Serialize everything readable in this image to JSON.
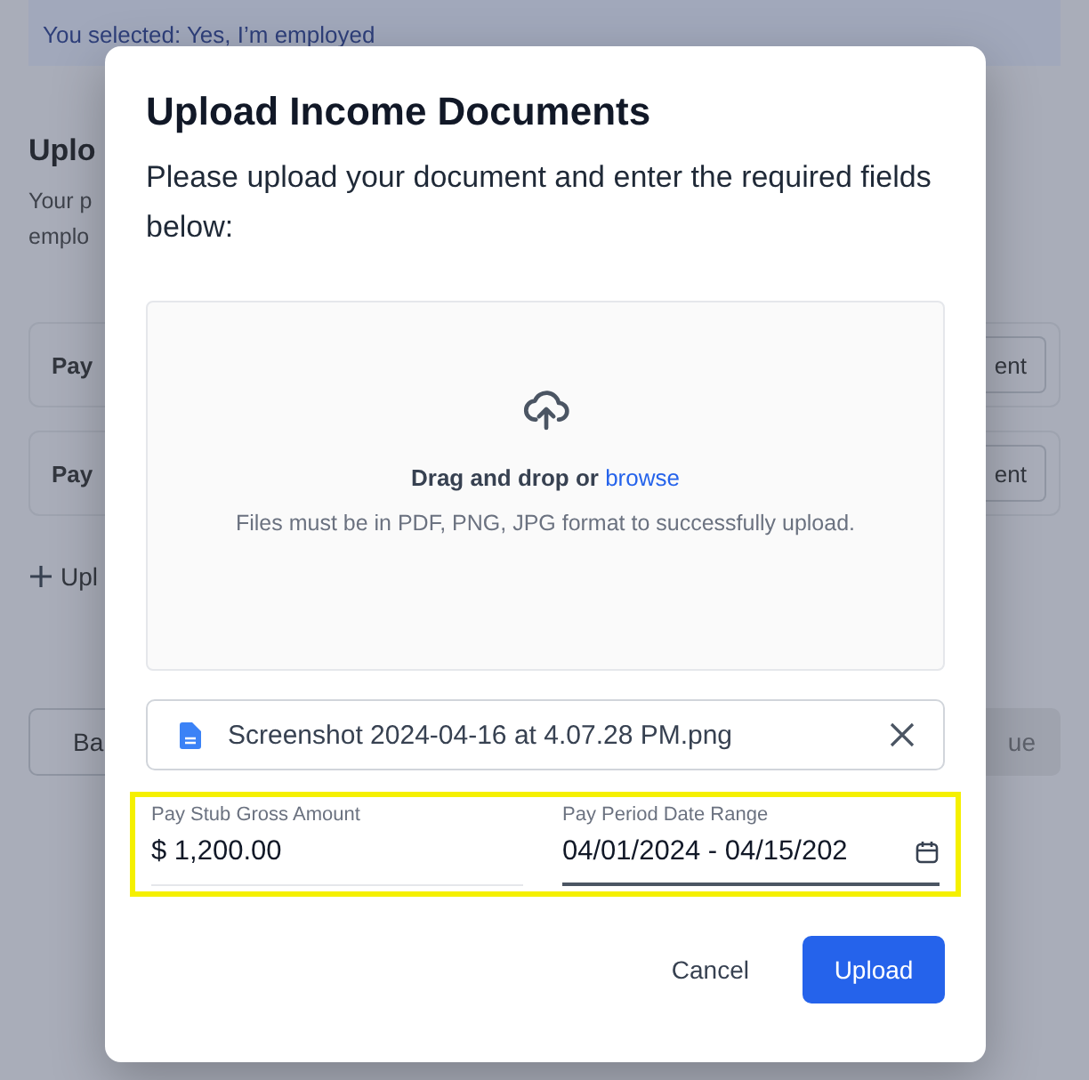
{
  "background": {
    "banner": "You selected: Yes, I’m employed",
    "heading": "Uplo",
    "description_lines": [
      "Your p",
      "emplo"
    ],
    "cards": [
      {
        "label": "Pay",
        "button": "ent"
      },
      {
        "label": "Pay",
        "button": "ent"
      }
    ],
    "add_link": "Upl",
    "back_button": "Ba",
    "continue_button": "ue"
  },
  "modal": {
    "title": "Upload Income Documents",
    "subtitle": "Please upload your document and enter the required fields below:",
    "dropzone": {
      "prompt": "Drag and drop or",
      "link": "browse",
      "hint": "Files must be in PDF, PNG, JPG format to successfully upload."
    },
    "file": {
      "name": "Screenshot 2024-04-16 at 4.07.28 PM.png"
    },
    "fields_highlighted": true,
    "fields": [
      {
        "kind": "amount",
        "label": "Pay Stub Gross Amount",
        "value": "$ 1,200.00"
      },
      {
        "kind": "date",
        "label": "Pay Period Date Range",
        "value": "04/01/2024 - 04/15/202"
      }
    ],
    "buttons": [
      {
        "label": "Cancel",
        "primary": false
      },
      {
        "label": "Upload",
        "primary": true
      }
    ]
  }
}
